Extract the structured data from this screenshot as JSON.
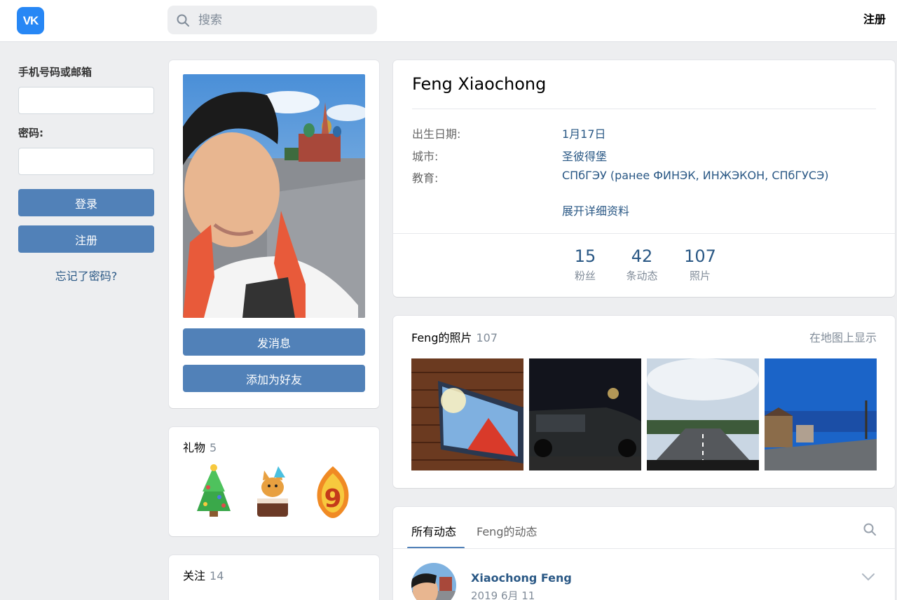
{
  "header": {
    "logo_text": "VK",
    "search_placeholder": "搜索",
    "register_label": "注册"
  },
  "login": {
    "phone_label": "手机号码或邮箱",
    "password_label": "密码:",
    "login_button": "登录",
    "register_button": "注册",
    "forgot_link": "忘记了密码?"
  },
  "avatar_card": {
    "message_button": "发消息",
    "add_friend_button": "添加为好友"
  },
  "gifts": {
    "title": "礼物",
    "count": "5",
    "items": [
      "christmas-tree-gift-icon",
      "cat-cake-gift-icon",
      "number-9-gift-icon"
    ]
  },
  "following": {
    "title": "关注",
    "count": "14"
  },
  "profile": {
    "name": "Feng Xiaochong",
    "birthday_label": "出生日期:",
    "birthday_value": "1月17日",
    "city_label": "城市:",
    "city_value": "圣彼得堡",
    "education_label": "教育:",
    "education_value": "СПбГЭУ (ранее ФИНЭК, ИНЖЭКОН, СПбГУСЭ)",
    "show_more": "展开详细资料",
    "counters": [
      {
        "num": "15",
        "label": "粉丝"
      },
      {
        "num": "42",
        "label": "条动态"
      },
      {
        "num": "107",
        "label": "照片"
      }
    ]
  },
  "photos": {
    "title": "Feng的照片",
    "count": "107",
    "map_link": "在地图上显示"
  },
  "wall": {
    "tab_all": "所有动态",
    "tab_own": "Feng的动态",
    "post_author": "Xiaochong Feng",
    "post_date": "2019 6月 11"
  },
  "colors": {
    "accent": "#5181b8",
    "link": "#2a5885",
    "background": "#edeef0",
    "logo": "#2787f5"
  }
}
